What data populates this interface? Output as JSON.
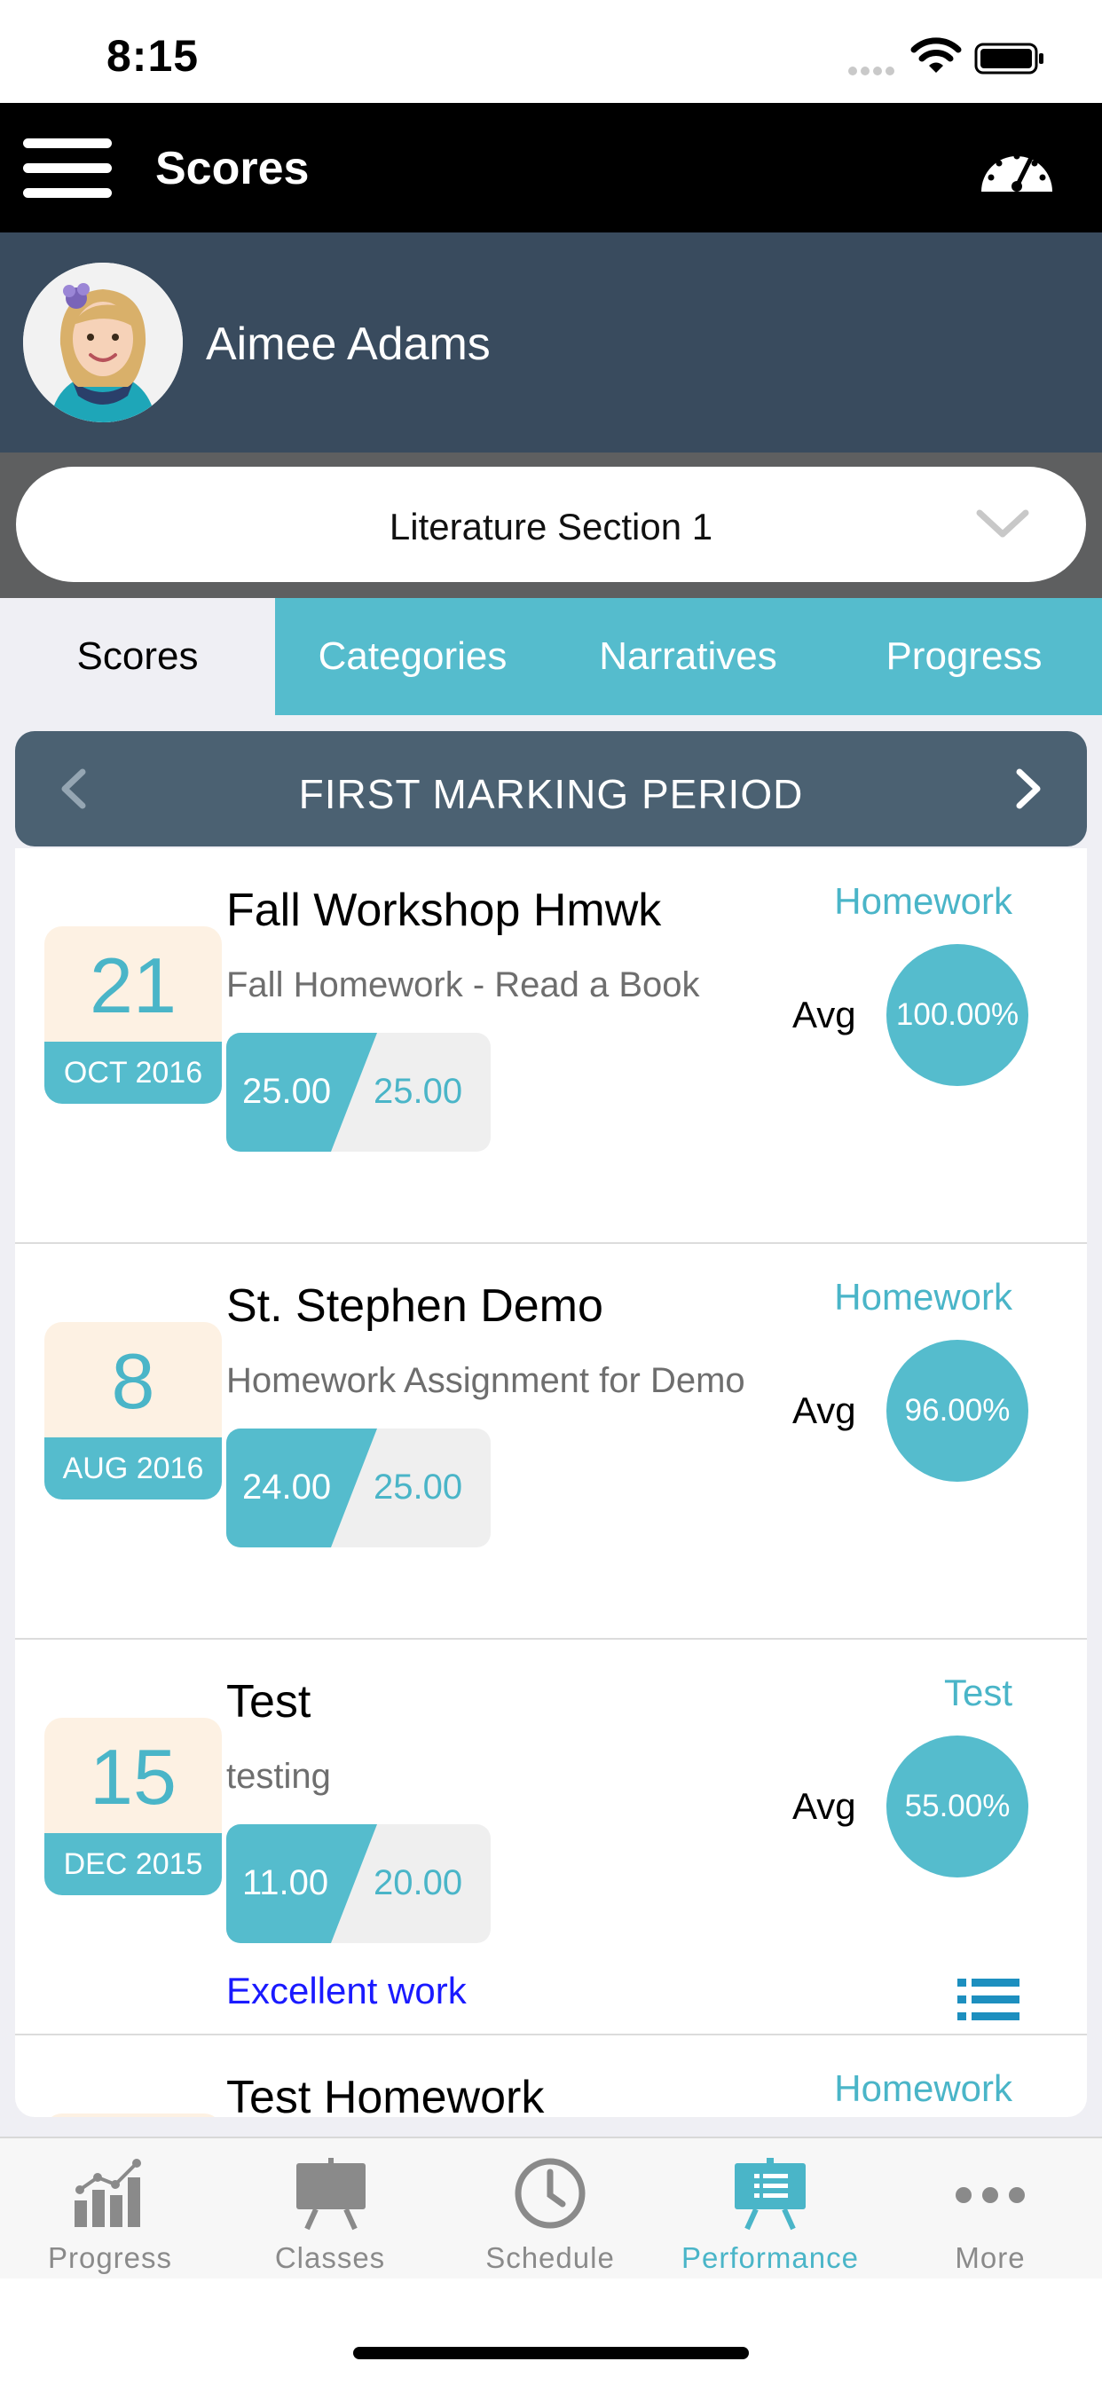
{
  "status_bar": {
    "time": "8:15"
  },
  "header": {
    "title": "Scores",
    "icon": "speedometer-icon"
  },
  "student": {
    "name": "Aimee Adams"
  },
  "section_selector": {
    "label": "Literature Section 1"
  },
  "tabs": [
    {
      "label": "Scores",
      "active": true
    },
    {
      "label": "Categories",
      "active": false
    },
    {
      "label": "Narratives",
      "active": false
    },
    {
      "label": "Progress",
      "active": false
    }
  ],
  "period": {
    "label": "FIRST MARKING PERIOD"
  },
  "assignments": [
    {
      "day": "21",
      "month_year": "OCT 2016",
      "title": "Fall Workshop Hmwk",
      "description": "Fall Homework - Read a Book",
      "earned": "25.00",
      "total": "25.00",
      "category": "Homework",
      "avg_label": "Avg",
      "avg": "100.00%"
    },
    {
      "day": "8",
      "month_year": "AUG 2016",
      "title": "St. Stephen Demo",
      "description": "Homework Assignment for Demo",
      "earned": "24.00",
      "total": "25.00",
      "category": "Homework",
      "avg_label": "Avg",
      "avg": "96.00%"
    },
    {
      "day": "15",
      "month_year": "DEC 2015",
      "title": "Test",
      "description": "testing",
      "earned": "11.00",
      "total": "20.00",
      "category": "Test",
      "avg_label": "Avg",
      "avg": "55.00%",
      "comment": "Excellent work"
    },
    {
      "day": "",
      "month_year": "",
      "title": "Test Homework",
      "description": "",
      "earned": "",
      "total": "",
      "category": "Homework",
      "avg_label": "",
      "avg": ""
    }
  ],
  "tab_bar": [
    {
      "label": "Progress",
      "icon": "bar-chart-icon",
      "active": false
    },
    {
      "label": "Classes",
      "icon": "easel-icon",
      "active": false
    },
    {
      "label": "Schedule",
      "icon": "clock-icon",
      "active": false
    },
    {
      "label": "Performance",
      "icon": "performance-board-icon",
      "active": true
    },
    {
      "label": "More",
      "icon": "more-dots-icon",
      "active": false
    }
  ],
  "colors": {
    "accent": "#55bccd",
    "header": "#000000",
    "profile_band": "#394b5e",
    "period_bar": "#4b6172",
    "date_bg": "#fdf1e3",
    "comment": "#1a1aff"
  }
}
